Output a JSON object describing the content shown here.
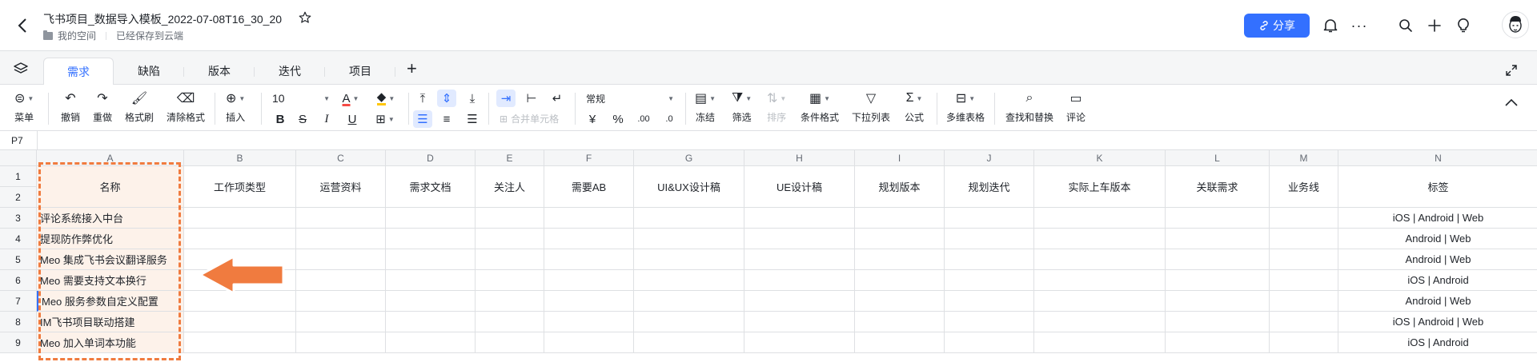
{
  "header": {
    "title": "飞书项目_数据导入模板_2022-07-08T16_30_20",
    "location": "我的空间",
    "save_status": "已经保存到云端",
    "share_label": "分享"
  },
  "tabs": [
    {
      "label": "需求",
      "active": true
    },
    {
      "label": "缺陷",
      "active": false
    },
    {
      "label": "版本",
      "active": false
    },
    {
      "label": "迭代",
      "active": false
    },
    {
      "label": "项目",
      "active": false
    }
  ],
  "toolbar": {
    "menu": "菜单",
    "undo": "撤销",
    "redo": "重做",
    "format_painter": "格式刷",
    "clear_format": "清除格式",
    "insert": "插入",
    "font_size": "10",
    "merge": "合并单元格",
    "number_format": "常规",
    "currency": "¥",
    "percent": "%",
    "freeze": "冻结",
    "filter": "筛选",
    "sort": "排序",
    "conditional_format": "条件格式",
    "dropdown_list": "下拉列表",
    "formula": "公式",
    "pivot": "多维表格",
    "find_replace": "查找和替换",
    "comment": "评论"
  },
  "cell_ref": "P7",
  "columns": [
    "A",
    "B",
    "C",
    "D",
    "E",
    "F",
    "G",
    "H",
    "I",
    "J",
    "K",
    "L",
    "M",
    "N"
  ],
  "header_row": [
    "名称",
    "工作项类型",
    "运营资料",
    "需求文档",
    "关注人",
    "需要AB",
    "UI&UX设计稿",
    "UE设计稿",
    "规划版本",
    "规划迭代",
    "实际上车版本",
    "关联需求",
    "业务线",
    "标签"
  ],
  "row_numbers": [
    "1",
    "2",
    "3",
    "4",
    "5",
    "6",
    "7",
    "8",
    "9"
  ],
  "rows": [
    {
      "name": "评论系统接入中台",
      "tag": "iOS | Android | Web"
    },
    {
      "name": "提现防作弊优化",
      "tag": "Android | Web"
    },
    {
      "name": "Meo 集成飞书会议翻译服务",
      "tag": "Android | Web"
    },
    {
      "name": "Meo 需要支持文本换行",
      "tag": "iOS | Android"
    },
    {
      "name": "Meo 服务参数自定义配置",
      "tag": "Android | Web"
    },
    {
      "name": "IM飞书项目联动搭建",
      "tag": "iOS | Android | Web"
    },
    {
      "name": "Meo 加入单词本功能",
      "tag": "iOS | Android"
    }
  ],
  "colors": {
    "accent": "#3370ff",
    "highlight_fill": "#fdf2ea",
    "annotation": "#f07b3f"
  }
}
